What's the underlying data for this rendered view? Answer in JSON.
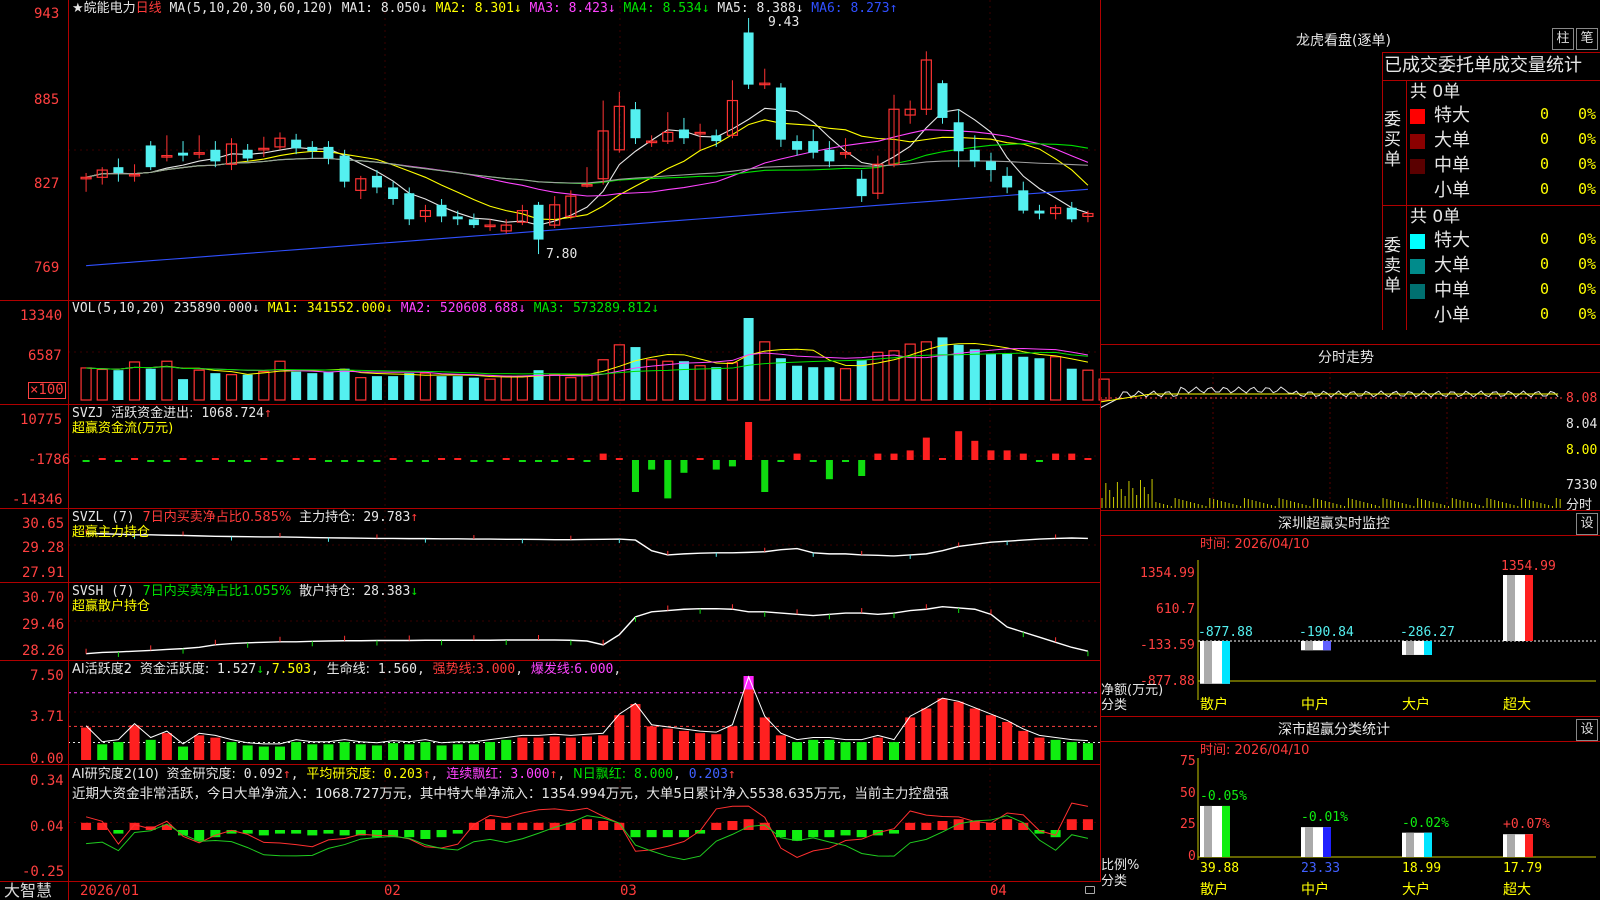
{
  "app": {
    "brand": "大智慧",
    "stock_title": "★皖能电力",
    "period": "日线"
  },
  "price_panel": {
    "ma_header": "MA(5,10,20,30,60,120)",
    "ma_items": [
      {
        "label": "MA1:",
        "value": "8.050",
        "arrow": "↓",
        "color": "#e6e6e6"
      },
      {
        "label": "MA2:",
        "value": "8.301",
        "arrow": "↓",
        "color": "#ffff00"
      },
      {
        "label": "MA3:",
        "value": "8.423",
        "arrow": "↓",
        "color": "#ff44ff"
      },
      {
        "label": "MA4:",
        "value": "8.534",
        "arrow": "↓",
        "color": "#00e000"
      },
      {
        "label": "MA5:",
        "value": "8.388",
        "arrow": "↓",
        "color": "#e6e6e6"
      },
      {
        "label": "MA6:",
        "value": "8.273",
        "arrow": "↑",
        "color": "#3050ff"
      }
    ],
    "y_ticks": [
      "943",
      "885",
      "827",
      "769"
    ],
    "high_label": "9.43",
    "low_label": "7.80"
  },
  "vol_panel": {
    "header": "VOL(5,10,20)",
    "value": "235890.000",
    "arrow": "↓",
    "items": [
      {
        "label": "MA1:",
        "value": "341552.000",
        "arrow": "↓",
        "color": "#ffff00"
      },
      {
        "label": "MA2:",
        "value": "520608.688",
        "arrow": "↓",
        "color": "#ff44ff"
      },
      {
        "label": "MA3:",
        "value": "573289.812",
        "arrow": "↓",
        "color": "#00e000"
      }
    ],
    "y_ticks": [
      "13340",
      "6587"
    ],
    "unit": "×100"
  },
  "svzj_panel": {
    "header": "SVZJ",
    "label": "活跃资金进出:",
    "value": "1068.724",
    "arrow": "↑",
    "sub": "超赢资金流(万元)",
    "y_ticks": [
      "10775",
      "-1786",
      "-14346"
    ]
  },
  "svzl_panel": {
    "header": "SVZL (7)",
    "ratio": "7日内买卖净占比0.585%",
    "label": "主力持仓:",
    "value": "29.783",
    "arrow": "↑",
    "sub": "超赢主力持仓",
    "y_ticks": [
      "30.65",
      "29.28",
      "27.91"
    ]
  },
  "svsh_panel": {
    "header": "SVSH (7)",
    "ratio": "7日内买卖净占比1.055%",
    "label": "散户持仓:",
    "value": "28.383",
    "arrow": "↓",
    "sub": "超赢散户持仓",
    "y_ticks": [
      "30.70",
      "29.46",
      "28.26"
    ]
  },
  "ai1_panel": {
    "header": "AI活跃度2",
    "label1": "资金活跃度:",
    "v1": "1.527",
    "a1": "↓",
    "v2": "7.503",
    "label3": "生命线:",
    "v3": "1.560",
    "label4": "强势线:",
    "v4": "3.000",
    "label5": "爆发线:",
    "v5": "6.000",
    "y_ticks": [
      "7.50",
      "3.71",
      "0.00"
    ]
  },
  "ai2_panel": {
    "header": "AI研究度2(10)",
    "label1": "资金研究度:",
    "v1": "0.092",
    "a1": "↑",
    "label2": "平均研究度:",
    "v2": "0.203",
    "a2": "↑",
    "label3": "连续飘红:",
    "v3": "3.000",
    "a3": "↑",
    "label4": "N日飘红:",
    "v4": "8.000",
    "v5": "0.203",
    "a5": "↑",
    "summary": "近期大资金非常活跃，今日大单净流入：1068.727万元，其中特大单净流入：1354.994万元，大单5日累计净入5538.635万元，当前主力控盘强",
    "y_ticks": [
      "0.34",
      "0.04",
      "-0.25"
    ]
  },
  "x_axis": [
    "2026/01",
    "02",
    "03",
    "04"
  ],
  "right": {
    "lhb_title": "龙虎看盘(逐单)",
    "btn_zhu": "柱",
    "btn_bi": "笔",
    "stats_title": "已成交委托单成交量统计",
    "buy_side": "委买单",
    "sell_side": "委卖单",
    "buy_total": "共 0单",
    "sell_total": "共 0单",
    "buy_rows": [
      {
        "name": "特大",
        "v": "0",
        "p": "0%",
        "color": "#ff0000"
      },
      {
        "name": "大单",
        "v": "0",
        "p": "0%",
        "color": "#8b0000"
      },
      {
        "name": "中单",
        "v": "0",
        "p": "0%",
        "color": "#5a0000"
      },
      {
        "name": "小单",
        "v": "0",
        "p": "0%",
        "color": "#000000"
      }
    ],
    "sell_rows": [
      {
        "name": "特大",
        "v": "0",
        "p": "0%",
        "color": "#00ffff"
      },
      {
        "name": "大单",
        "v": "0",
        "p": "0%",
        "color": "#008b8b"
      },
      {
        "name": "中单",
        "v": "0",
        "p": "0%",
        "color": "#007070"
      },
      {
        "name": "小单",
        "v": "0",
        "p": "0%",
        "color": "#000000"
      }
    ],
    "fenshi_title": "分时走势",
    "fenshi_ticks": [
      "8.08",
      "8.04",
      "8.00"
    ],
    "fenshi_vol": "7330",
    "fenshi_unit": "分时",
    "monitor_title": "深圳超赢实时监控",
    "monitor_btn": "设",
    "monitor_time": "时间: 2026/04/10",
    "monitor_ticks": [
      "1354.99",
      "610.7",
      "-133.59",
      "-877.88"
    ],
    "monitor_ylabel": "净额(万元)",
    "monitor_xlabel": "分类",
    "monitor_bars": [
      {
        "cat": "散户",
        "value": "-877.88"
      },
      {
        "cat": "中户",
        "value": "-190.84"
      },
      {
        "cat": "大户",
        "value": "-286.27"
      },
      {
        "cat": "超大",
        "value": "1354.99"
      }
    ],
    "classify_title": "深市超赢分类统计",
    "classify_btn": "设",
    "classify_time": "时间: 2026/04/10",
    "classify_ticks": [
      "75",
      "50",
      "25",
      "0"
    ],
    "classify_ylabel": "比例%",
    "classify_xlabel": "分类",
    "classify_bars": [
      {
        "cat": "散户",
        "value": "39.88",
        "delta": "-0.05%"
      },
      {
        "cat": "中户",
        "value": "23.33",
        "delta": "-0.01%"
      },
      {
        "cat": "大户",
        "value": "18.99",
        "delta": "-0.02%"
      },
      {
        "cat": "超大",
        "value": "17.79",
        "delta": "+0.07%"
      }
    ]
  },
  "chart_data": [
    {
      "type": "candlestick",
      "title": "皖能电力 日线",
      "ylim": [
        7.69,
        9.43
      ],
      "ohlc": [
        [
          8.33,
          8.33,
          8.36,
          8.23
        ],
        [
          8.33,
          8.38,
          8.4,
          8.28
        ],
        [
          8.4,
          8.36,
          8.46,
          8.3
        ],
        [
          8.35,
          8.35,
          8.42,
          8.3
        ],
        [
          8.55,
          8.4,
          8.58,
          8.38
        ],
        [
          8.48,
          8.48,
          8.62,
          8.44
        ],
        [
          8.5,
          8.48,
          8.58,
          8.44
        ],
        [
          8.5,
          8.5,
          8.62,
          8.46
        ],
        [
          8.52,
          8.44,
          8.58,
          8.4
        ],
        [
          8.42,
          8.56,
          8.6,
          8.38
        ],
        [
          8.52,
          8.46,
          8.56,
          8.44
        ],
        [
          8.53,
          8.53,
          8.61,
          8.47
        ],
        [
          8.54,
          8.6,
          8.64,
          8.52
        ],
        [
          8.59,
          8.53,
          8.63,
          8.49
        ],
        [
          8.54,
          8.51,
          8.58,
          8.46
        ],
        [
          8.54,
          8.46,
          8.58,
          8.42
        ],
        [
          8.48,
          8.3,
          8.52,
          8.26
        ],
        [
          8.24,
          8.32,
          8.34,
          8.18
        ],
        [
          8.34,
          8.26,
          8.38,
          8.22
        ],
        [
          8.26,
          8.18,
          8.3,
          8.14
        ],
        [
          8.22,
          8.04,
          8.26,
          8.0
        ],
        [
          8.06,
          8.1,
          8.14,
          8.02
        ],
        [
          8.14,
          8.06,
          8.18,
          8.02
        ],
        [
          8.06,
          8.04,
          8.1,
          8.0
        ],
        [
          8.04,
          8.0,
          8.08,
          7.98
        ],
        [
          8.0,
          8.0,
          8.04,
          7.96
        ],
        [
          7.96,
          8.0,
          8.04,
          7.94
        ],
        [
          8.02,
          8.1,
          8.14,
          8.0
        ],
        [
          8.14,
          7.9,
          8.16,
          7.8
        ],
        [
          8.0,
          8.14,
          8.2,
          7.98
        ],
        [
          8.06,
          8.2,
          8.24,
          8.04
        ],
        [
          8.28,
          8.28,
          8.4,
          8.26
        ],
        [
          8.32,
          8.65,
          8.86,
          8.28
        ],
        [
          8.52,
          8.82,
          8.92,
          8.5
        ],
        [
          8.8,
          8.6,
          8.85,
          8.56
        ],
        [
          8.58,
          8.58,
          8.62,
          8.54
        ],
        [
          8.58,
          8.64,
          8.78,
          8.56
        ],
        [
          8.66,
          8.6,
          8.74,
          8.56
        ],
        [
          8.64,
          8.64,
          8.7,
          8.52
        ],
        [
          8.62,
          8.58,
          8.66,
          8.54
        ],
        [
          8.62,
          8.86,
          9.0,
          8.6
        ],
        [
          9.33,
          8.97,
          9.43,
          8.94
        ],
        [
          8.98,
          8.98,
          9.08,
          8.94
        ],
        [
          8.95,
          8.59,
          8.98,
          8.54
        ],
        [
          8.58,
          8.52,
          8.62,
          8.48
        ],
        [
          8.58,
          8.5,
          8.66,
          8.46
        ],
        [
          8.52,
          8.44,
          8.58,
          8.4
        ],
        [
          8.5,
          8.5,
          8.6,
          8.46
        ],
        [
          8.32,
          8.2,
          8.38,
          8.16
        ],
        [
          8.22,
          8.42,
          8.48,
          8.18
        ],
        [
          8.42,
          8.8,
          8.9,
          8.4
        ],
        [
          8.76,
          8.8,
          8.86,
          8.7
        ],
        [
          8.8,
          9.14,
          9.2,
          8.76
        ],
        [
          8.98,
          8.74,
          9.0,
          8.7
        ],
        [
          8.71,
          8.51,
          8.8,
          8.4
        ],
        [
          8.52,
          8.44,
          8.62,
          8.4
        ],
        [
          8.44,
          8.38,
          8.5,
          8.3
        ],
        [
          8.34,
          8.26,
          8.4,
          8.22
        ],
        [
          8.24,
          8.1,
          8.3,
          8.08
        ],
        [
          8.1,
          8.08,
          8.14,
          8.04
        ],
        [
          8.08,
          8.12,
          8.14,
          8.04
        ],
        [
          8.12,
          8.04,
          8.16,
          8.02
        ],
        [
          8.06,
          8.08,
          8.1,
          8.02
        ]
      ]
    },
    {
      "type": "bar",
      "title": "VOL",
      "values": [
        4.3,
        4.1,
        4.0,
        5.1,
        4.2,
        5.2,
        2.8,
        4.0,
        3.6,
        3.4,
        3.4,
        3.8,
        5.2,
        3.8,
        3.6,
        3.8,
        4.2,
        3.0,
        3.2,
        3.2,
        3.6,
        3.6,
        3.2,
        3.2,
        3.0,
        2.8,
        3.2,
        3.2,
        4.0,
        3.4,
        3.0,
        3.4,
        5.4,
        7.4,
        7.1,
        5.4,
        5.2,
        5.2,
        4.6,
        4.4,
        5.0,
        11.0,
        7.8,
        5.6,
        4.6,
        4.4,
        4.4,
        4.2,
        5.4,
        6.4,
        6.6,
        7.5,
        7.8,
        8.4,
        7.4,
        6.8,
        6.2,
        6.2,
        5.8,
        5.6,
        5.8,
        4.2,
        4.0,
        2.8
      ]
    },
    {
      "type": "bar",
      "title": "SVZJ",
      "values": [
        -1,
        1,
        -1,
        1,
        -1,
        -1,
        1,
        -1,
        1,
        -1,
        -1,
        1,
        -1,
        1,
        1,
        -1,
        -1,
        -1,
        -1,
        1,
        -1,
        -1,
        1,
        1,
        -1,
        -1,
        1,
        -1,
        -1,
        -1,
        1,
        -1,
        2,
        1,
        -10,
        -3,
        -12,
        -4,
        1,
        -3,
        -2,
        10775,
        -10,
        -1,
        2,
        -1,
        -6,
        -1,
        -5,
        2,
        2,
        3,
        7,
        1,
        9,
        6,
        3,
        3,
        2,
        -1,
        2,
        2,
        1,
        1
      ],
      "unit": "万元"
    },
    {
      "type": "line",
      "title": "SVZL 主力持仓",
      "values": [
        30.02,
        30.0,
        29.98,
        29.95,
        29.95,
        29.93,
        29.92,
        29.9,
        29.88,
        29.87,
        29.86,
        29.85,
        29.85,
        29.84,
        29.82,
        29.81,
        29.8,
        29.79,
        29.78,
        29.78,
        29.77,
        29.77,
        29.76,
        29.76,
        29.75,
        29.75,
        29.74,
        29.74,
        29.73,
        29.72,
        29.72,
        29.73,
        29.74,
        29.75,
        29.7,
        29.2,
        29.0,
        29.05,
        29.08,
        29.1,
        29.1,
        29.12,
        29.15,
        29.25,
        29.3,
        29.1,
        29.05,
        29.05,
        29.0,
        28.98,
        28.95,
        29.0,
        29.05,
        29.2,
        29.4,
        29.5,
        29.6,
        29.65,
        29.7,
        29.75,
        29.78,
        29.8,
        29.78,
        29.78
      ]
    },
    {
      "type": "line",
      "title": "SVSH 散户持仓",
      "values": [
        28.35,
        28.4,
        28.42,
        28.45,
        28.48,
        28.52,
        28.55,
        28.6,
        28.7,
        28.75,
        28.78,
        28.8,
        28.82,
        28.82,
        28.84,
        28.85,
        28.86,
        28.86,
        28.87,
        28.87,
        28.87,
        28.88,
        28.88,
        28.88,
        28.88,
        28.88,
        28.89,
        28.89,
        28.89,
        28.89,
        28.88,
        28.85,
        28.7,
        29.1,
        29.8,
        30.0,
        30.05,
        30.1,
        30.12,
        30.12,
        30.1,
        30.0,
        30.0,
        29.95,
        29.9,
        29.85,
        29.9,
        29.95,
        29.95,
        29.9,
        29.95,
        30.05,
        30.1,
        30.2,
        30.15,
        30.1,
        29.9,
        29.4,
        29.2,
        29.0,
        28.8,
        28.6,
        28.45,
        28.38
      ]
    },
    {
      "type": "bar",
      "title": "AI活跃度2",
      "values": [
        2.9,
        1.4,
        1.6,
        3.1,
        1.8,
        2.4,
        1.2,
        2.2,
        2.0,
        1.6,
        1.3,
        1.2,
        1.2,
        1.6,
        1.4,
        1.4,
        1.6,
        1.4,
        1.3,
        1.5,
        1.4,
        1.6,
        1.3,
        1.4,
        1.4,
        1.6,
        1.8,
        2.0,
        2.0,
        2.1,
        2.0,
        2.1,
        2.2,
        4.0,
        5.0,
        3.0,
        2.8,
        2.6,
        2.4,
        2.3,
        3.0,
        7.5,
        3.8,
        2.2,
        1.6,
        1.8,
        1.8,
        1.6,
        1.6,
        2.0,
        1.6,
        3.8,
        4.6,
        5.5,
        5.2,
        4.6,
        4.0,
        3.4,
        2.6,
        2.0,
        1.8,
        1.6,
        1.5,
        1.4
      ],
      "lines": {
        "强势线": 3.0,
        "爆发线": 6.0
      }
    },
    {
      "type": "bar",
      "title": "AI研究度2(10)",
      "values": [
        0.04,
        0.04,
        -0.02,
        0.04,
        0.02,
        0.03,
        -0.03,
        -0.06,
        -0.04,
        -0.02,
        -0.02,
        -0.03,
        -0.02,
        -0.02,
        -0.03,
        -0.02,
        -0.03,
        -0.03,
        -0.04,
        -0.04,
        -0.04,
        -0.05,
        -0.04,
        -0.02,
        0.04,
        0.06,
        0.04,
        0.04,
        0.04,
        0.04,
        0.04,
        0.06,
        0.05,
        0.04,
        -0.04,
        -0.04,
        -0.04,
        -0.04,
        -0.02,
        0.04,
        0.05,
        0.06,
        0.04,
        -0.04,
        -0.06,
        -0.04,
        -0.04,
        -0.03,
        -0.04,
        -0.03,
        -0.02,
        0.04,
        0.04,
        0.05,
        0.06,
        0.05,
        0.04,
        0.06,
        0.04,
        -0.02,
        -0.04,
        0.06,
        0.06,
        0.08
      ]
    }
  ]
}
